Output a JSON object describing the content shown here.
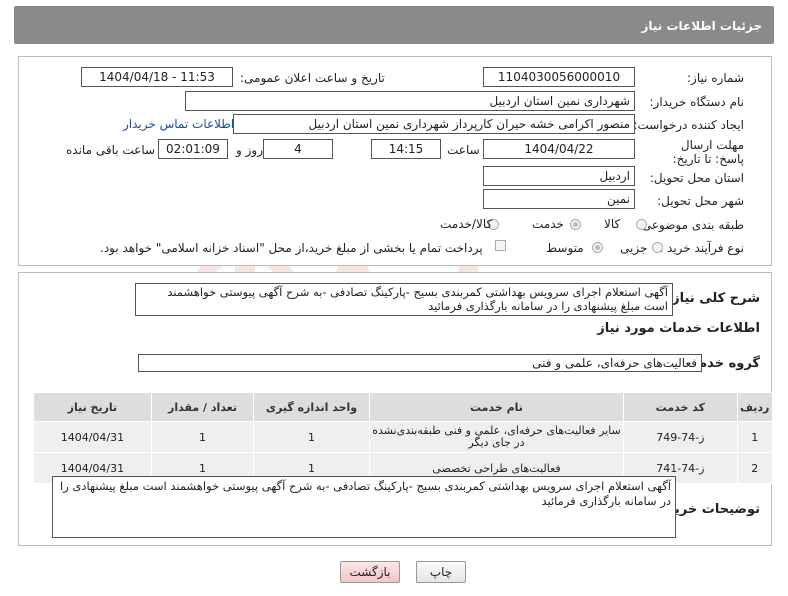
{
  "header": {
    "title": "جزئیات اطلاعات نیاز"
  },
  "form": {
    "need_number_label": "شماره نیاز:",
    "need_number": "1104030056000010",
    "announce_label": "تاریخ و ساعت اعلان عمومی:",
    "announce_value": "1404/04/18 - 11:53",
    "buyer_label": "نام دستگاه خریدار:",
    "buyer_value": "شهرداری نمین استان اردبیل",
    "requester_label": "ایجاد کننده درخواست:",
    "requester_value": "منصور اکرامی خشه حیران کارپرداز شهرداری نمین استان اردبیل",
    "contact_link": "اطلاعات تماس خریدار",
    "deadline_label": "مهلت ارسال پاسخ: تا تاریخ:",
    "deadline_date": "1404/04/22",
    "time_label": "ساعت",
    "deadline_time": "14:15",
    "days_value": "4",
    "days_label": "روز و",
    "remaining_value": "02:01:09",
    "remaining_label": "ساعت باقی مانده",
    "province_label": "استان محل تحویل:",
    "province_value": "اردبیل",
    "city_label": "شهر محل تحویل:",
    "city_value": "نمین",
    "category_label": "طبقه بندی موضوعی:",
    "category_options": [
      "کالا",
      "خدمت",
      "کالا/خدمت"
    ],
    "process_label": "نوع فرآیند خرید :",
    "process_options": [
      "جزیی",
      "متوسط"
    ],
    "payment_note": "پرداخت تمام یا بخشی از مبلغ خرید،از محل \"اسناد خزانه اسلامی\" خواهد بود."
  },
  "summary": {
    "label": "شرح کلی نیاز:",
    "text": "آگهی استعلام اجرای سرویس بهداشتی کمربندی بسیج -پارکینگ تصادفی -به شرح آگهی پیوستی خواهشمند است مبلغ پیشنهادی را در سامانه بارگذاری فرمائید"
  },
  "services": {
    "section_title": "اطلاعات خدمات مورد نیاز",
    "group_label": "گروه خدمت:",
    "group_value": "فعالیت‌های حرفه‌ای، علمی و فنی",
    "columns": [
      "ردیف",
      "کد خدمت",
      "نام خدمت",
      "واحد اندازه گیری",
      "تعداد / مقدار",
      "تاریخ نیاز"
    ],
    "rows": [
      [
        "1",
        "ز-74-749",
        "سایر فعالیت‌های حرفه‌ای، علمی و فنی طبقه‌بندی‌نشده در جای دیگر",
        "1",
        "1",
        "1404/04/31"
      ],
      [
        "2",
        "ز-74-741",
        "فعالیت‌های طراحی تخصصی",
        "1",
        "1",
        "1404/04/31"
      ]
    ]
  },
  "buyer_notes": {
    "label": "توضیحات خریدار:",
    "text": "آگهی استعلام اجرای سرویس بهداشتی کمربندی بسیج -پارکینگ تصادفی -به شرح آگهی پیوستی خواهشمند است مبلغ پیشنهادی را در سامانه بارگذاری فرمائید"
  },
  "buttons": {
    "print": "چاپ",
    "back": "بازگشت"
  },
  "colors": {
    "header_bg": "#8a8a8a",
    "link": "#1a4fa0",
    "back_btn": "#f7d4d4"
  }
}
